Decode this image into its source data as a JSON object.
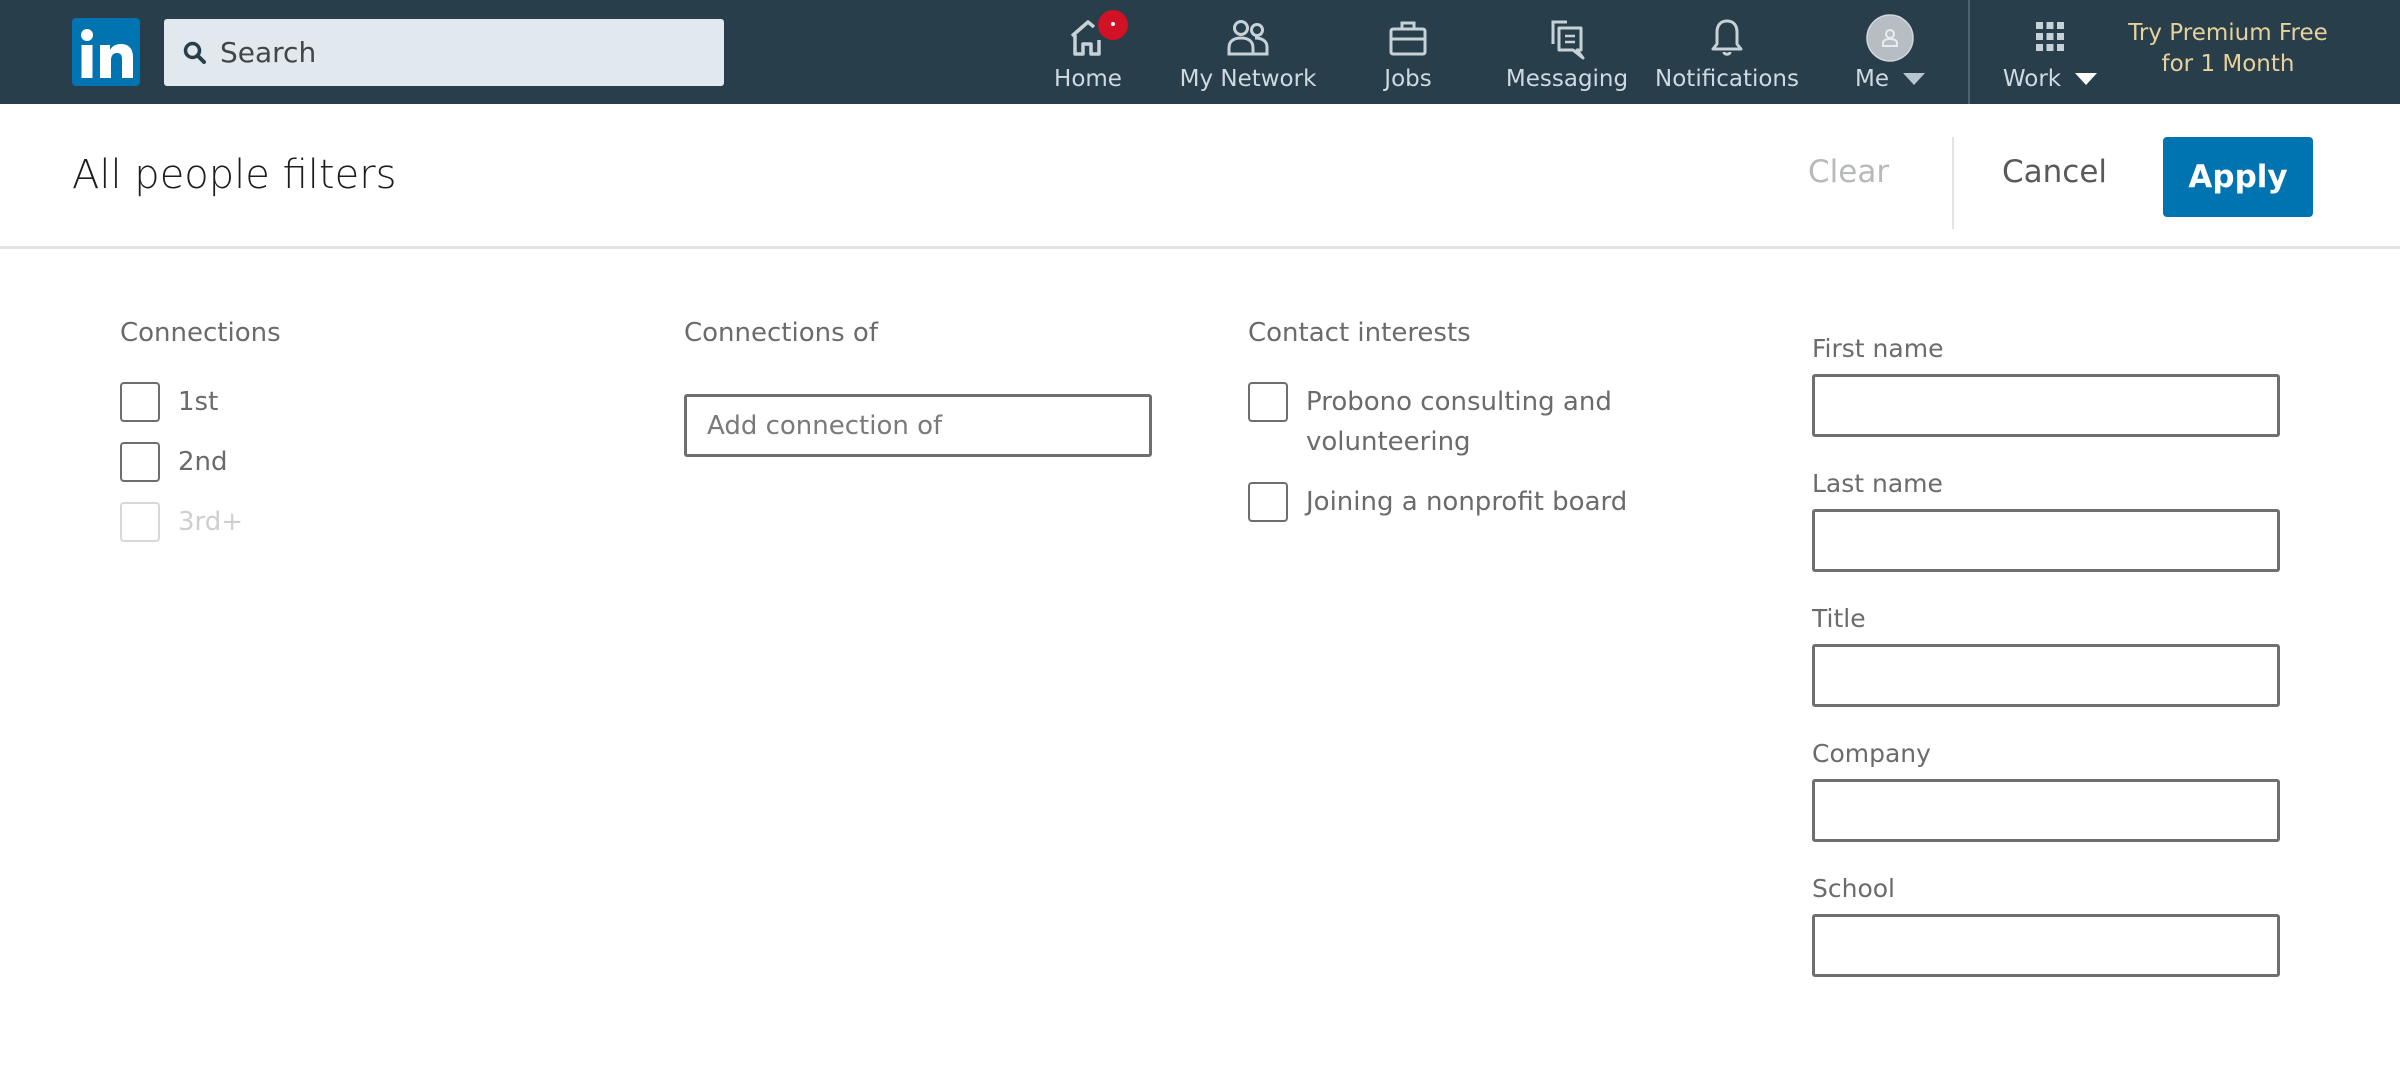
{
  "nav": {
    "logo_text": "in",
    "search": {
      "placeholder": "Search",
      "value": ""
    },
    "items": [
      {
        "label": "Home",
        "icon": "home-icon",
        "has_badge": true
      },
      {
        "label": "My Network",
        "icon": "my-network-icon"
      },
      {
        "label": "Jobs",
        "icon": "jobs-briefcase-icon"
      },
      {
        "label": "Messaging",
        "icon": "messaging-icon"
      },
      {
        "label": "Notifications",
        "icon": "notifications-bell-icon"
      },
      {
        "label": "Me",
        "icon": "avatar-icon",
        "dropdown": true
      },
      {
        "label": "Work",
        "icon": "grid-icon",
        "dropdown": true
      }
    ],
    "premium": {
      "line1": "Try Premium Free",
      "line2": "for 1 Month"
    },
    "colors": {
      "bar": "#283e4a",
      "badge": "#d11124",
      "premium": "#e7d19c",
      "brand": "#0073b1"
    }
  },
  "header": {
    "title": "All people filters",
    "clear_label": "Clear",
    "cancel_label": "Cancel",
    "apply_label": "Apply"
  },
  "filters": {
    "connections": {
      "label": "Connections",
      "options": [
        {
          "label": "1st",
          "checked": false,
          "disabled": false
        },
        {
          "label": "2nd",
          "checked": false,
          "disabled": false
        },
        {
          "label": "3rd+",
          "checked": false,
          "disabled": true
        }
      ]
    },
    "connections_of": {
      "label": "Connections of",
      "placeholder": "Add connection of",
      "value": ""
    },
    "contact_interests": {
      "label": "Contact interests",
      "options": [
        {
          "label": "Probono consulting and volunteering",
          "checked": false
        },
        {
          "label": "Joining a nonprofit board",
          "checked": false
        }
      ]
    },
    "keywords": [
      {
        "label": "First name",
        "value": ""
      },
      {
        "label": "Last name",
        "value": ""
      },
      {
        "label": "Title",
        "value": ""
      },
      {
        "label": "Company",
        "value": ""
      },
      {
        "label": "School",
        "value": ""
      }
    ]
  }
}
